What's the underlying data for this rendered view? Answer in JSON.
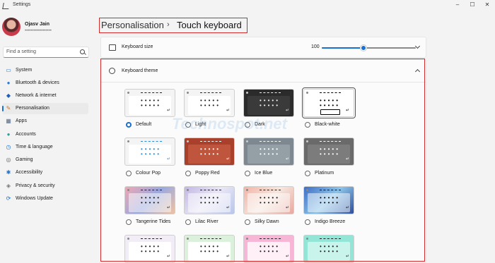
{
  "app": {
    "title": "Settings"
  },
  "window_controls": {
    "minimize": "–",
    "maximize": "☐",
    "close": "✕"
  },
  "user": {
    "name": "Ojasv Jain",
    "email": "••••••••••••••••••"
  },
  "search": {
    "placeholder": "Find a setting"
  },
  "nav": [
    {
      "label": "System",
      "icon": "system-icon",
      "glyph": "▭",
      "color": "#1a6fd1"
    },
    {
      "label": "Bluetooth & devices",
      "icon": "bluetooth-icon",
      "glyph": "●",
      "color": "#2a7ad8"
    },
    {
      "label": "Network & internet",
      "icon": "network-icon",
      "glyph": "◆",
      "color": "#1d5fb8"
    },
    {
      "label": "Personalisation",
      "icon": "brush-icon",
      "glyph": "✎",
      "color": "#c77b2a",
      "active": true
    },
    {
      "label": "Apps",
      "icon": "apps-icon",
      "glyph": "▦",
      "color": "#5a6f8a"
    },
    {
      "label": "Accounts",
      "icon": "accounts-icon",
      "glyph": "●",
      "color": "#2ea0a0"
    },
    {
      "label": "Time & language",
      "icon": "clock-icon",
      "glyph": "◷",
      "color": "#1a6fd1"
    },
    {
      "label": "Gaming",
      "icon": "gaming-icon",
      "glyph": "◎",
      "color": "#666"
    },
    {
      "label": "Accessibility",
      "icon": "accessibility-icon",
      "glyph": "✱",
      "color": "#1a6fd1"
    },
    {
      "label": "Privacy & security",
      "icon": "shield-icon",
      "glyph": "◈",
      "color": "#777"
    },
    {
      "label": "Windows Update",
      "icon": "update-icon",
      "glyph": "⟳",
      "color": "#1a6fd1"
    }
  ],
  "breadcrumb": {
    "parent": "Personalisation",
    "separator": "›",
    "current": "Touch keyboard"
  },
  "keyboard_size": {
    "label": "Keyboard size",
    "value": "100",
    "slider_fraction": 0.44
  },
  "keyboard_theme": {
    "label": "Keyboard theme",
    "themes": [
      {
        "label": "Default",
        "selected": true,
        "bg": "#f4f4f4",
        "inner": "#ffffff",
        "fg": "#222",
        "accent": "#1a6fd1"
      },
      {
        "label": "Light",
        "bg": "#f4f4f4",
        "inner": "#ffffff",
        "fg": "#222"
      },
      {
        "label": "Dark",
        "bg": "#2b2b2b",
        "inner": "#3a3a3a",
        "fg": "#eee"
      },
      {
        "label": "Black-white",
        "bg": "#ffffff",
        "inner": "#ffffff",
        "fg": "#000",
        "outlined": true
      },
      {
        "label": "Colour Pop",
        "bg": "#f4f4f4",
        "inner": "#ffffff",
        "fg": "#2a8ad8"
      },
      {
        "label": "Poppy Red",
        "bg": "#a8402c",
        "inner": "#c0553e",
        "fg": "#fff"
      },
      {
        "label": "Ice Blue",
        "bg": "#7d8890",
        "inner": "#949fa6",
        "fg": "#fff"
      },
      {
        "label": "Platinum",
        "bg": "#6a6a6a",
        "inner": "#7c7c7c",
        "fg": "#fff"
      },
      {
        "label": "Tangerine Tides",
        "bg": "linear-gradient(135deg,#f1a6b2,#9aa9e0,#f0c2a0)",
        "inner": "rgba(255,255,255,0.5)",
        "fg": "#222"
      },
      {
        "label": "Lilac River",
        "bg": "linear-gradient(135deg,#c2b7e6,#e9e6f5,#b8c6ea)",
        "inner": "rgba(255,255,255,0.5)",
        "fg": "#222"
      },
      {
        "label": "Silky Dawn",
        "bg": "linear-gradient(135deg,#f3b3a6,#f6e6dd,#e8a8a0)",
        "inner": "rgba(255,255,255,0.5)",
        "fg": "#222"
      },
      {
        "label": "Indigo Breeze",
        "bg": "linear-gradient(135deg,#3f6fc4,#8bc3e8,#2d4f9f)",
        "inner": "rgba(255,255,255,0.5)",
        "fg": "#111"
      },
      {
        "label": "",
        "bg": "#f1ecf6",
        "inner": "#ffffff",
        "fg": "#222"
      },
      {
        "label": "",
        "bg": "#dcf1dc",
        "inner": "#ffffff",
        "fg": "#222"
      },
      {
        "label": "",
        "bg": "#f7b6d5",
        "inner": "#fff0f7",
        "fg": "#222"
      },
      {
        "label": "",
        "bg": "#93e5d8",
        "inner": "#c8f4ec",
        "fg": "#222"
      }
    ]
  },
  "watermark": "Technospot.net",
  "colors": {
    "accent": "#1a6fd1",
    "highlight": "#d12d2d"
  }
}
